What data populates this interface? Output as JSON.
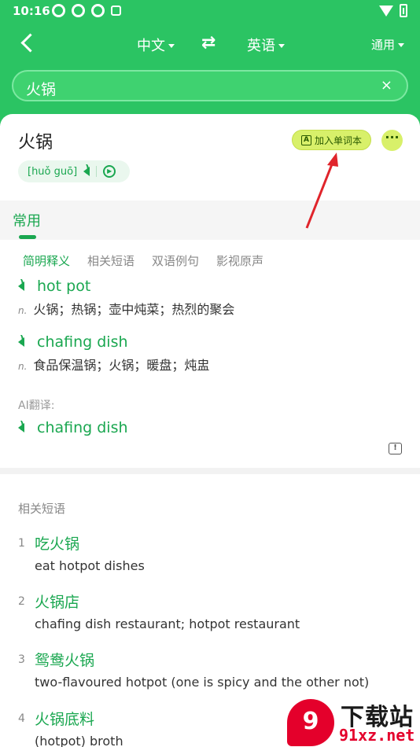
{
  "status": {
    "time": "10:16"
  },
  "nav": {
    "source_lang": "中文",
    "target_lang": "英语",
    "swap_icon": "⇄",
    "mode": "通用"
  },
  "search": {
    "value": "火锅",
    "clear_icon": "×"
  },
  "word": {
    "headword": "火锅",
    "pinyin": "[huǒ guō]",
    "add_vocab": "加入单词本",
    "more": "···"
  },
  "tabs": {
    "main": "常用"
  },
  "subtabs": [
    "简明释义",
    "相关短语",
    "双语例句",
    "影视原声"
  ],
  "definitions": [
    {
      "en": "hot pot",
      "pos": "n.",
      "zh": "火锅；热锅；壶中炖菜；热烈的聚会"
    },
    {
      "en": "chafing dish",
      "pos": "n.",
      "zh": "食品保温锅；火锅；暖盘；炖盅"
    }
  ],
  "ai": {
    "label": "AI翻译:",
    "translation": "chafing dish"
  },
  "phrases": {
    "title": "相关短语",
    "items": [
      {
        "num": "1",
        "term": "吃火锅",
        "translation": "eat hotpot dishes"
      },
      {
        "num": "2",
        "term": "火锅店",
        "translation": "chafing dish restaurant; hotpot restaurant"
      },
      {
        "num": "3",
        "term": "鸳鸯火锅",
        "translation": "two-flavoured hotpot (one is spicy and the other not)"
      },
      {
        "num": "4",
        "term": "火锅底料",
        "translation": "(hotpot) broth"
      }
    ]
  },
  "watermark": {
    "logo": "9",
    "text": "下载站",
    "url": "91xz.net"
  },
  "colors": {
    "brand": "#2bc463",
    "accent_green": "#1aa750",
    "highlight": "#d8f06a",
    "annotation_arrow": "#e0242b"
  }
}
